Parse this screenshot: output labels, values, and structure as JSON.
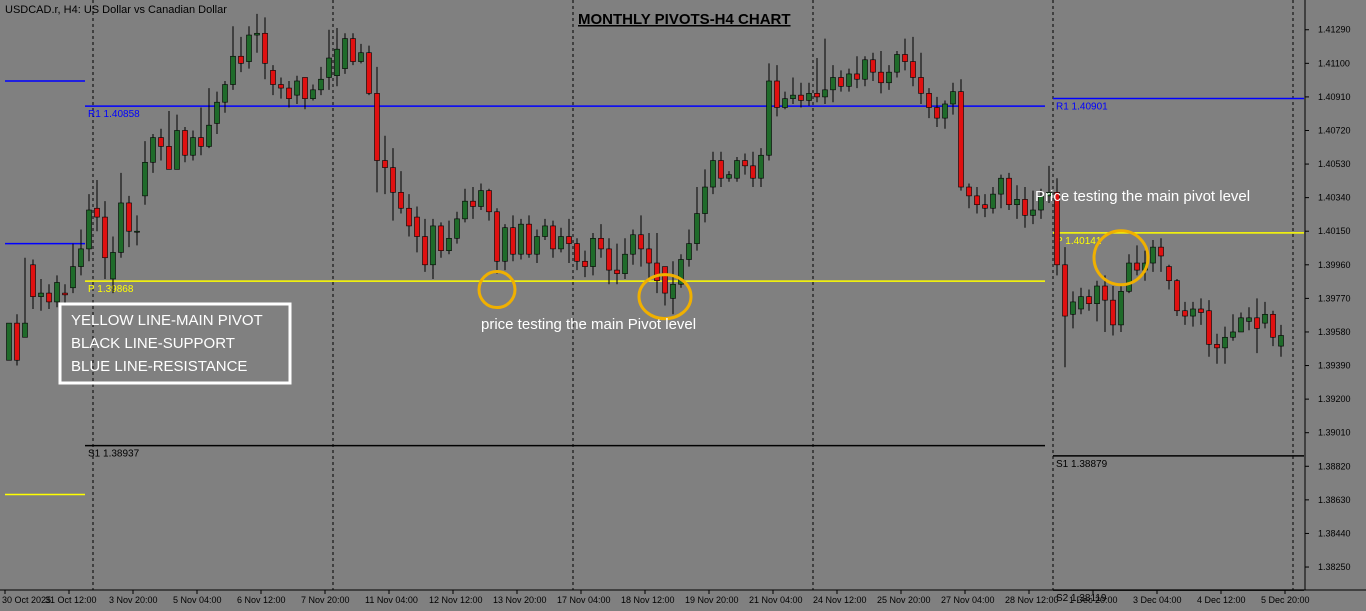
{
  "header": {
    "symbol_info": "USDCAD.r, H4:  US Dollar vs Canadian Dollar",
    "title": "MONTHLY PIVOTS-H4 CHART"
  },
  "legend_box": {
    "line1": "YELLOW LINE-MAIN PIVOT",
    "line2": "BLACK LINE-SUPPORT",
    "line3": "BLUE LINE-RESISTANCE"
  },
  "annotations": {
    "left_note": "price testing the main Pivot level",
    "right_note": "Price testing the main pivot level"
  },
  "colors": {
    "background": "#808080",
    "bull": "#1f6b2a",
    "bear": "#e01010",
    "pivot": "#ffff00",
    "resistance": "#0000ff",
    "support": "#000000",
    "circle": "#f0b000"
  },
  "chart_data": {
    "type": "candlestick",
    "title": "MONTHLY PIVOTS-H4 CHART",
    "ylim": [
      1.3812,
      1.4143
    ],
    "y_ticks": [
      "1.41290",
      "1.41100",
      "1.40910",
      "1.40720",
      "1.40530",
      "1.40340",
      "1.40150",
      "1.39960",
      "1.39770",
      "1.39580",
      "1.39390",
      "1.39200",
      "1.39010",
      "1.38820",
      "1.38630",
      "1.38440",
      "1.38250"
    ],
    "x_ticks": [
      {
        "i": 0,
        "label": "30 Oct 2025"
      },
      {
        "i": 8,
        "label": "31 Oct 12:00"
      },
      {
        "i": 16,
        "label": "3 Nov 20:00"
      },
      {
        "i": 24,
        "label": "5 Nov 04:00"
      },
      {
        "i": 32,
        "label": "6 Nov 12:00"
      },
      {
        "i": 40,
        "label": "7 Nov 20:00"
      },
      {
        "i": 48,
        "label": "11 Nov 04:00"
      },
      {
        "i": 56,
        "label": "12 Nov 12:00"
      },
      {
        "i": 64,
        "label": "13 Nov 20:00"
      },
      {
        "i": 72,
        "label": "17 Nov 04:00"
      },
      {
        "i": 80,
        "label": "18 Nov 12:00"
      },
      {
        "i": 88,
        "label": "19 Nov 20:00"
      },
      {
        "i": 96,
        "label": "21 Nov 04:00"
      },
      {
        "i": 104,
        "label": "24 Nov 12:00"
      },
      {
        "i": 112,
        "label": "25 Nov 20:00"
      },
      {
        "i": 120,
        "label": "27 Nov 04:00"
      },
      {
        "i": 128,
        "label": "28 Nov 12:00"
      },
      {
        "i": 136,
        "label": "1 Dec 20:00"
      },
      {
        "i": 144,
        "label": "3 Dec 04:00"
      },
      {
        "i": 152,
        "label": "4 Dec 12:00"
      },
      {
        "i": 160,
        "label": "5 Dec 20:00"
      }
    ],
    "period_separators": [
      11,
      41,
      71,
      101,
      131,
      161
    ],
    "levels": [
      {
        "name": "R1",
        "label": "R1 1.40858",
        "value": 1.40858,
        "i_from": 10,
        "i_to": 130,
        "role": "resistance"
      },
      {
        "name": "P",
        "label": "P 1.39868",
        "value": 1.39868,
        "i_from": 10,
        "i_to": 130,
        "role": "pivot"
      },
      {
        "name": "S1",
        "label": "S1 1.38937",
        "value": 1.38937,
        "i_from": 10,
        "i_to": 130,
        "role": "support"
      },
      {
        "name": "R1",
        "label": "R1 1.40901",
        "value": 1.40901,
        "i_from": 131,
        "i_to": 171,
        "role": "resistance"
      },
      {
        "name": "P",
        "label": "P 1.40141",
        "value": 1.40141,
        "i_from": 131,
        "i_to": 171,
        "role": "pivot"
      },
      {
        "name": "S1",
        "label": "S1 1.38879",
        "value": 1.38879,
        "i_from": 131,
        "i_to": 171,
        "role": "support"
      },
      {
        "name": "S2",
        "label": "S2 1.38119",
        "value": 1.38119,
        "i_from": 131,
        "i_to": 171,
        "role": "support"
      },
      {
        "name": "prev",
        "label": "",
        "value": 1.41,
        "i_from": 0,
        "i_to": 10,
        "role": "resistance"
      },
      {
        "name": "prev",
        "label": "",
        "value": 1.4008,
        "i_from": 0,
        "i_to": 10,
        "role": "resistance"
      },
      {
        "name": "prev",
        "label": "",
        "value": 1.3866,
        "i_from": 0,
        "i_to": 10,
        "role": "pivot"
      }
    ],
    "highlight_circles": [
      {
        "i": 61,
        "value": 1.3982
      },
      {
        "i": 82,
        "value": 1.3978
      },
      {
        "i": 139,
        "value": 1.4
      }
    ],
    "candles": [
      [
        1.3942,
        1.3963,
        1.3928,
        1.3928
      ],
      [
        1.3963,
        1.3942,
        1.3968,
        1.3939
      ],
      [
        1.3955,
        1.3963,
        1.4,
        1.3955
      ],
      [
        1.3996,
        1.3978,
        1.3999,
        1.3971
      ],
      [
        1.3978,
        1.398,
        1.3988,
        1.397
      ],
      [
        1.398,
        1.3975,
        1.3985,
        1.3971
      ],
      [
        1.3975,
        1.3986,
        1.399,
        1.3972
      ],
      [
        1.398,
        1.3979,
        1.3985,
        1.3973
      ],
      [
        1.3983,
        1.3995,
        1.4008,
        1.398
      ],
      [
        1.3995,
        1.4005,
        1.4016,
        1.399
      ],
      [
        1.4005,
        1.4027,
        1.4036,
        1.3998
      ],
      [
        1.4028,
        1.4023,
        1.4044,
        1.4015
      ],
      [
        1.4023,
        1.4,
        1.4032,
        1.3988
      ],
      [
        1.3988,
        1.4003,
        1.4012,
        1.398
      ],
      [
        1.4003,
        1.4031,
        1.4048,
        1.4
      ],
      [
        1.4031,
        1.4015,
        1.4035,
        1.4006
      ],
      [
        1.4015,
        1.4015,
        1.4024,
        1.4007
      ],
      [
        1.4035,
        1.4054,
        1.4066,
        1.403
      ],
      [
        1.4054,
        1.4068,
        1.407,
        1.4048
      ],
      [
        1.4068,
        1.4063,
        1.4073,
        1.4055
      ],
      [
        1.4063,
        1.405,
        1.4083,
        1.4052
      ],
      [
        1.405,
        1.4072,
        1.4081,
        1.4051
      ],
      [
        1.4072,
        1.4058,
        1.4074,
        1.4054
      ],
      [
        1.4058,
        1.4068,
        1.4072,
        1.4055
      ],
      [
        1.4068,
        1.4063,
        1.4085,
        1.4058
      ],
      [
        1.4063,
        1.4075,
        1.4096,
        1.4062
      ],
      [
        1.4076,
        1.4088,
        1.4094,
        1.407
      ],
      [
        1.4088,
        1.4098,
        1.41,
        1.4082
      ],
      [
        1.4098,
        1.4114,
        1.4131,
        1.4095
      ],
      [
        1.4114,
        1.411,
        1.4125,
        1.4105
      ],
      [
        1.4111,
        1.4126,
        1.4131,
        1.4107
      ],
      [
        1.4126,
        1.4127,
        1.4138,
        1.4116
      ],
      [
        1.4127,
        1.411,
        1.4136,
        1.4101
      ],
      [
        1.4106,
        1.4098,
        1.4109,
        1.4092
      ],
      [
        1.4098,
        1.4096,
        1.4102,
        1.409
      ],
      [
        1.4096,
        1.409,
        1.41,
        1.4085
      ],
      [
        1.4092,
        1.41,
        1.4103,
        1.4087
      ],
      [
        1.4102,
        1.409,
        1.4102,
        1.4084
      ],
      [
        1.409,
        1.4095,
        1.4098,
        1.4089
      ],
      [
        1.4095,
        1.4101,
        1.4108,
        1.4092
      ],
      [
        1.4102,
        1.4113,
        1.4129,
        1.4095
      ],
      [
        1.4103,
        1.4118,
        1.413,
        1.4097
      ],
      [
        1.4107,
        1.4124,
        1.4127,
        1.4104
      ],
      [
        1.4124,
        1.4111,
        1.4127,
        1.4109
      ],
      [
        1.4111,
        1.4116,
        1.4121,
        1.411
      ],
      [
        1.4116,
        1.4093,
        1.412,
        1.4092
      ],
      [
        1.4093,
        1.4055,
        1.4108,
        1.4037
      ],
      [
        1.4055,
        1.4051,
        1.4069,
        1.4036
      ],
      [
        1.4051,
        1.4037,
        1.4062,
        1.4021
      ],
      [
        1.4037,
        1.4028,
        1.4049,
        1.4025
      ],
      [
        1.4028,
        1.4018,
        1.4036,
        1.4012
      ],
      [
        1.4023,
        1.4012,
        1.4029,
        1.4003
      ],
      [
        1.4012,
        1.3996,
        1.4022,
        1.3992
      ],
      [
        1.3996,
        1.4018,
        1.4022,
        1.3988
      ],
      [
        1.4018,
        1.4004,
        1.402,
        1.4
      ],
      [
        1.4004,
        1.4011,
        1.4021,
        1.4002
      ],
      [
        1.4011,
        1.4022,
        1.4026,
        1.4008
      ],
      [
        1.4022,
        1.4032,
        1.4039,
        1.402
      ],
      [
        1.4032,
        1.4029,
        1.404,
        1.4022
      ],
      [
        1.4029,
        1.4038,
        1.4042,
        1.4027
      ],
      [
        1.4038,
        1.4026,
        1.4039,
        1.4021
      ],
      [
        1.4026,
        1.3998,
        1.4028,
        1.3991
      ],
      [
        1.3998,
        1.4017,
        1.4019,
        1.3993
      ],
      [
        1.4017,
        1.4002,
        1.4024,
        1.3998
      ],
      [
        1.4002,
        1.4019,
        1.4022,
        1.3999
      ],
      [
        1.4019,
        1.4002,
        1.4024,
        1.4
      ],
      [
        1.4002,
        1.4012,
        1.4016,
        1.3997
      ],
      [
        1.4012,
        1.4018,
        1.4022,
        1.401
      ],
      [
        1.4018,
        1.4005,
        1.4021,
        1.4
      ],
      [
        1.4005,
        1.4012,
        1.4017,
        1.4003
      ],
      [
        1.4012,
        1.4008,
        1.4022,
        1.3997
      ],
      [
        1.4008,
        1.3998,
        1.4011,
        1.3993
      ],
      [
        1.3998,
        1.3995,
        1.4004,
        1.3989
      ],
      [
        1.3995,
        1.4011,
        1.4014,
        1.399
      ],
      [
        1.4011,
        1.4005,
        1.4019,
        1.4
      ],
      [
        1.4005,
        1.3993,
        1.4011,
        1.3985
      ],
      [
        1.3993,
        1.3991,
        1.4008,
        1.3985
      ],
      [
        1.3991,
        1.4002,
        1.4011,
        1.3988
      ],
      [
        1.4002,
        1.4013,
        1.4016,
        1.3996
      ],
      [
        1.4013,
        1.4005,
        1.4024,
        1.3995
      ],
      [
        1.4005,
        1.3997,
        1.4014,
        1.3987
      ],
      [
        1.3997,
        1.3987,
        1.4014,
        1.398
      ],
      [
        1.3995,
        1.398,
        1.3992,
        1.3973
      ],
      [
        1.3977,
        1.3985,
        1.3998,
        1.3968
      ],
      [
        1.3985,
        1.3999,
        1.4002,
        1.3983
      ],
      [
        1.3999,
        1.4008,
        1.4016,
        1.3995
      ],
      [
        1.4008,
        1.4025,
        1.404,
        1.4004
      ],
      [
        1.4025,
        1.404,
        1.405,
        1.402
      ],
      [
        1.404,
        1.4055,
        1.406,
        1.4036
      ],
      [
        1.4055,
        1.4045,
        1.406,
        1.404
      ],
      [
        1.4045,
        1.4047,
        1.4049,
        1.4043
      ],
      [
        1.4045,
        1.4055,
        1.4057,
        1.4043
      ],
      [
        1.4055,
        1.4052,
        1.4059,
        1.4047
      ],
      [
        1.4052,
        1.4045,
        1.406,
        1.404
      ],
      [
        1.4045,
        1.4058,
        1.4062,
        1.404
      ],
      [
        1.4058,
        1.41,
        1.411,
        1.4055
      ],
      [
        1.41,
        1.4085,
        1.4109,
        1.408
      ],
      [
        1.4085,
        1.409,
        1.4094,
        1.4084
      ],
      [
        1.409,
        1.4092,
        1.4102,
        1.4087
      ],
      [
        1.4092,
        1.4089,
        1.4099,
        1.4085
      ],
      [
        1.4089,
        1.4093,
        1.4099,
        1.4086
      ],
      [
        1.4093,
        1.4091,
        1.4113,
        1.4088
      ],
      [
        1.4091,
        1.4095,
        1.4124,
        1.4087
      ],
      [
        1.4095,
        1.4102,
        1.4109,
        1.4088
      ],
      [
        1.4102,
        1.4097,
        1.4106,
        1.4094
      ],
      [
        1.4097,
        1.4104,
        1.4107,
        1.4094
      ],
      [
        1.4104,
        1.4101,
        1.4114,
        1.4096
      ],
      [
        1.4101,
        1.4112,
        1.4114,
        1.4097
      ],
      [
        1.4112,
        1.4105,
        1.4116,
        1.41
      ],
      [
        1.4105,
        1.4099,
        1.4117,
        1.4093
      ],
      [
        1.4099,
        1.4105,
        1.4109,
        1.4095
      ],
      [
        1.4105,
        1.4115,
        1.4117,
        1.4102
      ],
      [
        1.4115,
        1.4111,
        1.4124,
        1.4106
      ],
      [
        1.4111,
        1.4102,
        1.4125,
        1.4097
      ],
      [
        1.4102,
        1.4093,
        1.4116,
        1.4087
      ],
      [
        1.4093,
        1.4085,
        1.4096,
        1.4079
      ],
      [
        1.4085,
        1.4079,
        1.4091,
        1.4074
      ],
      [
        1.4079,
        1.4087,
        1.4089,
        1.4073
      ],
      [
        1.4087,
        1.4094,
        1.4099,
        1.4081
      ],
      [
        1.4094,
        1.404,
        1.4101,
        1.4038
      ],
      [
        1.404,
        1.4035,
        1.4042,
        1.4028
      ],
      [
        1.4035,
        1.403,
        1.404,
        1.4025
      ],
      [
        1.403,
        1.4028,
        1.4036,
        1.4023
      ],
      [
        1.4028,
        1.4036,
        1.404,
        1.4025
      ],
      [
        1.4036,
        1.4045,
        1.4047,
        1.4028
      ],
      [
        1.4045,
        1.403,
        1.4048,
        1.4027
      ],
      [
        1.403,
        1.4033,
        1.4041,
        1.4022
      ],
      [
        1.4033,
        1.4024,
        1.404,
        1.4017
      ],
      [
        1.4024,
        1.4027,
        1.4038,
        1.4019
      ],
      [
        1.4027,
        1.4035,
        1.4039,
        1.4022
      ],
      [
        1.4035,
        1.4037,
        1.4052,
        1.4031
      ],
      [
        1.4037,
        1.3996,
        1.4045,
        1.399
      ],
      [
        1.3996,
        1.3967,
        1.4006,
        1.3938
      ],
      [
        1.3968,
        1.3975,
        1.3981,
        1.396
      ],
      [
        1.3971,
        1.3978,
        1.3983,
        1.3968
      ],
      [
        1.3978,
        1.3974,
        1.3982,
        1.397
      ],
      [
        1.3974,
        1.3984,
        1.3987,
        1.3964
      ],
      [
        1.3984,
        1.3976,
        1.399,
        1.3958
      ],
      [
        1.3976,
        1.3962,
        1.3984,
        1.3956
      ],
      [
        1.3962,
        1.3981,
        1.3985,
        1.3958
      ],
      [
        1.3981,
        1.3997,
        1.4002,
        1.398
      ],
      [
        1.3997,
        1.3993,
        1.4007,
        1.399
      ],
      [
        1.3993,
        1.3997,
        1.4004,
        1.3987
      ],
      [
        1.3997,
        1.4006,
        1.401,
        1.3992
      ],
      [
        1.4006,
        1.4001,
        1.4011,
        1.3992
      ],
      [
        1.3995,
        1.3987,
        1.3996,
        1.3982
      ],
      [
        1.3987,
        1.397,
        1.3988,
        1.3967
      ],
      [
        1.397,
        1.3967,
        1.3975,
        1.3962
      ],
      [
        1.3967,
        1.3971,
        1.3975,
        1.3961
      ],
      [
        1.3971,
        1.3969,
        1.3977,
        1.3962
      ],
      [
        1.397,
        1.3951,
        1.3976,
        1.3944
      ],
      [
        1.3951,
        1.3949,
        1.3957,
        1.394
      ],
      [
        1.3949,
        1.3955,
        1.3961,
        1.394
      ],
      [
        1.3955,
        1.3958,
        1.3968,
        1.3953
      ],
      [
        1.3958,
        1.3966,
        1.3969,
        1.3958
      ],
      [
        1.3964,
        1.3966,
        1.3972,
        1.3959
      ],
      [
        1.3966,
        1.396,
        1.3977,
        1.3946
      ],
      [
        1.3963,
        1.3968,
        1.3975,
        1.396
      ],
      [
        1.3968,
        1.3955,
        1.397,
        1.395
      ],
      [
        1.395,
        1.3956,
        1.3962,
        1.3944
      ]
    ]
  }
}
